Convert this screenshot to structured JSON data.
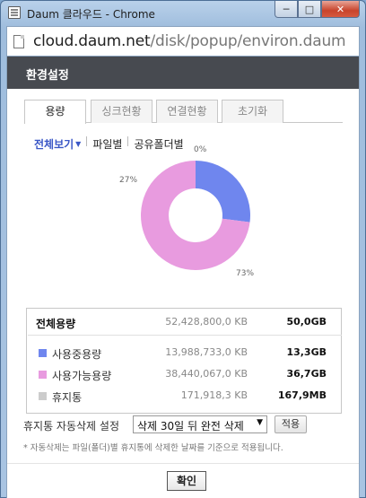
{
  "window": {
    "title": "Daum 클라우드 - Chrome",
    "url_host": "cloud.daum.net",
    "url_path": "/disk/popup/environ.daum"
  },
  "header": {
    "title": "환경설정"
  },
  "tabs": [
    {
      "label": "용량",
      "active": true
    },
    {
      "label": "싱크현황",
      "active": false
    },
    {
      "label": "연결현황",
      "active": false
    },
    {
      "label": "초기화",
      "active": false
    }
  ],
  "subnav": {
    "all_view": "전체보기",
    "by_file": "파일별",
    "shared_folder": "공유폴더별"
  },
  "chart_data": {
    "type": "pie",
    "labels": [
      "사용중용량",
      "사용가능용량",
      "휴지통"
    ],
    "values": [
      27,
      73,
      0
    ],
    "value_labels": [
      "27%",
      "73%",
      "0%"
    ],
    "colors": [
      "#6f86ee",
      "#e89bdf",
      "#cccccc"
    ]
  },
  "usage": {
    "total": {
      "label": "전체용량",
      "raw": "52,428,800,0 KB",
      "gb": "50,0GB"
    },
    "items": [
      {
        "label": "사용중용량",
        "raw": "13,988,733,0 KB",
        "gb": "13,3GB",
        "color": "#6f86ee"
      },
      {
        "label": "사용가능용량",
        "raw": "38,440,067,0 KB",
        "gb": "36,7GB",
        "color": "#e89bdf"
      },
      {
        "label": "휴지통",
        "raw": "171,918,3 KB",
        "gb": "167,9MB",
        "color": "#cccccc"
      }
    ]
  },
  "autodelete": {
    "label": "휴지통 자동삭제 설정",
    "selected": "삭제 30일 뒤 완전 삭제",
    "apply": "적용",
    "note": "* 자동삭제는 파일(폴더)별 휴지통에 삭제한 날짜를 기준으로 적용됩니다."
  },
  "footer": {
    "confirm": "확인"
  }
}
